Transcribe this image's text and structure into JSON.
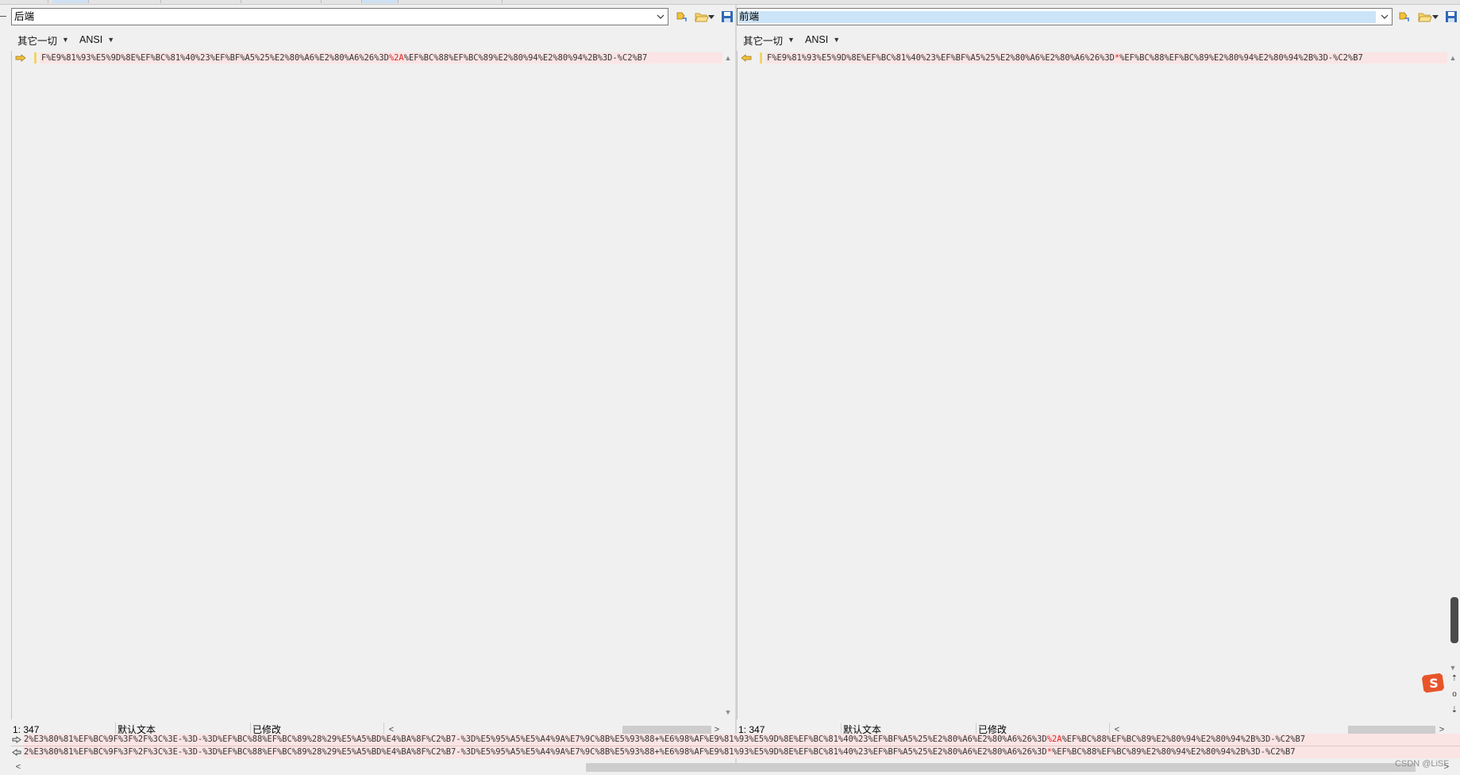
{
  "left_pane": {
    "path": "后端",
    "encoding_menu": {
      "rules_label": "其它一切",
      "encoding_label": "ANSI"
    },
    "line_text": {
      "before": "F%E9%81%93%E5%9D%8E%EF%BC%81%40%23%EF%BF%A5%25%E2%80%A6%E2%80%A6%26%3D",
      "diff": "%2A",
      "after": "%EF%BC%88%EF%BC%89%E2%80%94%E2%80%94%2B%3D-%C2%B7"
    },
    "status": {
      "position": "1: 347",
      "mode": "默认文本",
      "state": "已修改"
    }
  },
  "right_pane": {
    "path": "前端",
    "encoding_menu": {
      "rules_label": "其它一切",
      "encoding_label": "ANSI"
    },
    "line_text": {
      "before": "F%E9%81%93%E5%9D%8E%EF%BC%81%40%23%EF%BF%A5%25%E2%80%A6%E2%80%A6%26%3D",
      "diff": "*",
      "after": "%EF%BC%88%EF%BC%89%E2%80%94%E2%80%94%2B%3D-%C2%B7"
    },
    "status": {
      "position": "1: 347",
      "mode": "默认文本",
      "state": "已修改"
    }
  },
  "detail_panel": {
    "line1": {
      "before": "2%E3%80%81%EF%BC%9F%3F%2F%3C%3E-%3D-%3D%EF%BC%88%EF%BC%89%28%29%E5%A5%BD%E4%BA%8F%C2%B7-%3D%E5%95%A5%E5%A4%9A%E7%9C%8B%E5%93%88+%E6%98%AF%E9%81%93%E5%9D%8E%EF%BC%81%40%23%EF%BF%A5%25%E2%80%A6%E2%80%A6%26%3D",
      "diff": "%2A",
      "after": "%EF%BC%88%EF%BC%89%E2%80%94%E2%80%94%2B%3D-%C2%B7"
    },
    "line2": {
      "before": "2%E3%80%81%EF%BC%9F%3F%2F%3C%3E-%3D-%3D%EF%BC%88%EF%BC%89%28%29%E5%A5%BD%E4%BA%8F%C2%B7-%3D%E5%95%A5%E5%A4%9A%E7%9C%8B%E5%93%88+%E6%98%AF%E9%81%93%E5%9D%8E%EF%BC%81%40%23%EF%BF%A5%25%E2%80%A6%E2%80%A6%26%3D",
      "diff": "*",
      "after": "%EF%BC%88%EF%BC%89%E2%80%94%E2%80%94%2B%3D-%C2%B7"
    }
  },
  "watermark": "CSDN @LiSF",
  "colors": {
    "diff_highlight": "#e02424",
    "line_background": "#fbe4e4",
    "selection": "#cce4f7",
    "marker_yellow": "#f3d36b",
    "ime_orange": "#e8542a"
  },
  "icons": {
    "left_pane": [
      "copy-to-other-icon",
      "folder-open-icon",
      "save-icon"
    ],
    "right_pane": [
      "copy-to-other-icon",
      "folder-open-icon",
      "save-icon"
    ],
    "markers": [
      "arrow-right-icon",
      "arrow-left-icon"
    ],
    "ime": "sogou-ime-icon"
  }
}
